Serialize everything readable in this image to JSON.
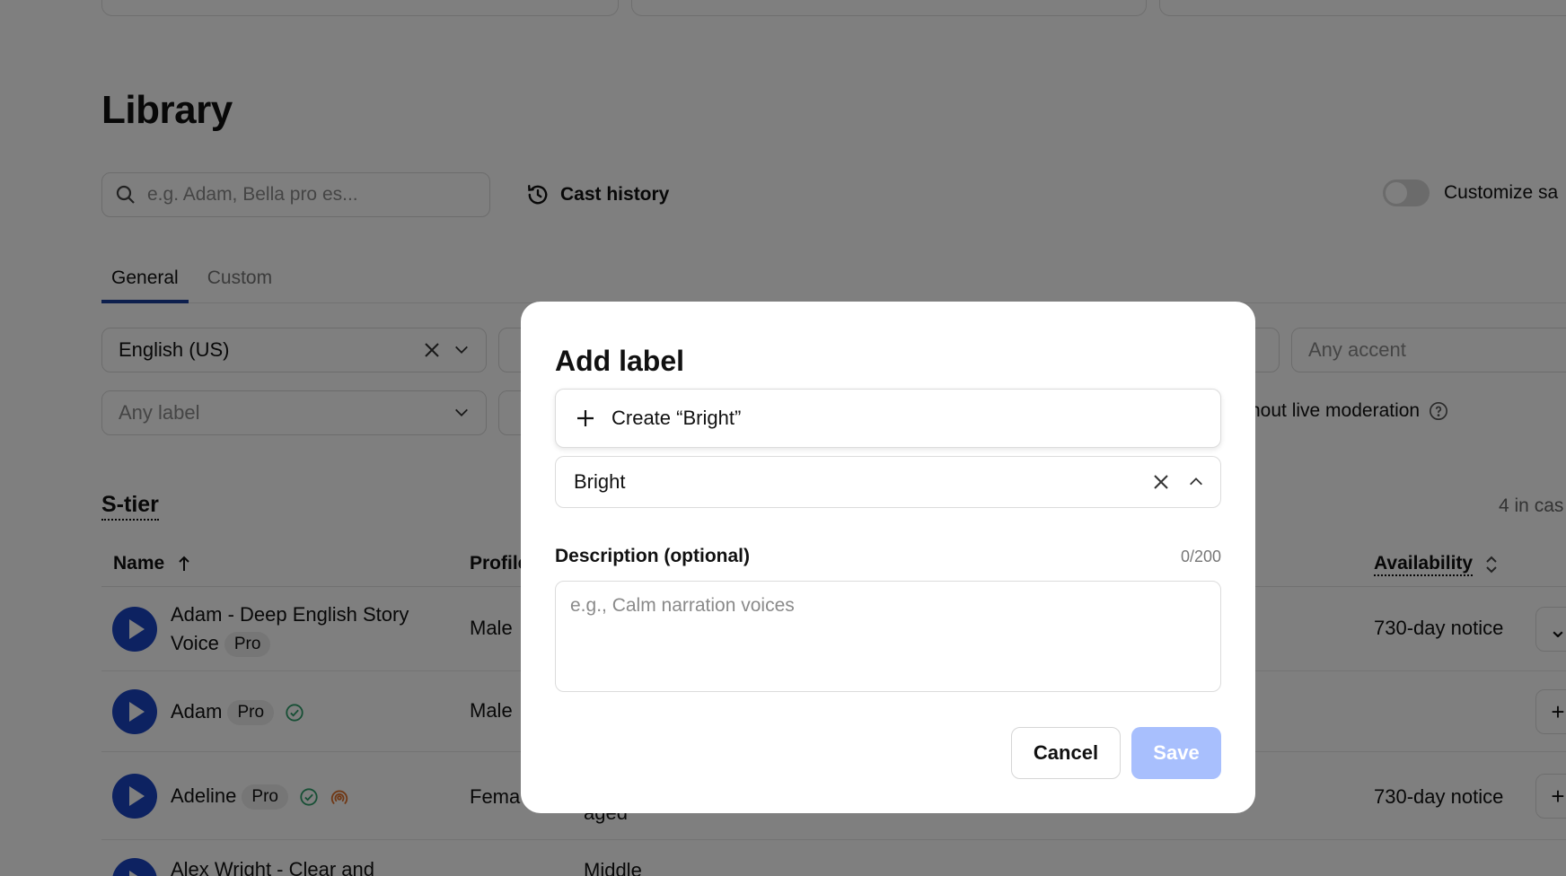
{
  "library": {
    "title": "Library",
    "search_placeholder": "e.g. Adam, Bella pro es...",
    "cast_history_label": "Cast history",
    "customize_label": "Customize sa",
    "tabs": [
      {
        "label": "General",
        "active": true
      },
      {
        "label": "Custom",
        "active": false
      }
    ],
    "filters": {
      "language_value": "English (US)",
      "accent_placeholder": "Any accent",
      "label_placeholder": "Any label",
      "moderation_text": "hout live moderation"
    },
    "section_title": "S-tier",
    "section_count": "4 in cas",
    "table": {
      "headers": {
        "name": "Name",
        "profile": "Profile",
        "availability": "Availability"
      },
      "rows": [
        {
          "name_line1": "Adam - Deep English Story",
          "name_line2": "Voice",
          "badge": "Pro",
          "profile": "Male",
          "availability": "730-day notice",
          "action": "⌄"
        },
        {
          "name": "Adam",
          "badge": "Pro",
          "profile": "Male",
          "availability": "",
          "action": "+"
        },
        {
          "name": "Adeline",
          "badge": "Pro",
          "profile": "Fema",
          "extra": "aged",
          "availability": "730-day notice",
          "action": "+"
        },
        {
          "name_line1": "Alex Wright - Clear and",
          "extra": "Middle"
        }
      ]
    }
  },
  "modal": {
    "title": "Add label",
    "create_option": "Create “Bright”",
    "label_value": "Bright",
    "description_label": "Description (optional)",
    "counter": "0/200",
    "description_placeholder": "e.g., Calm narration voices",
    "cancel_label": "Cancel",
    "save_label": "Save"
  },
  "colors": {
    "accent_blue": "#1a44c2",
    "tab_underline": "#1a3e9a",
    "save_disabled": "#a8bffd",
    "verified_green": "#2e9e6a",
    "live_orange": "#e0702a"
  }
}
